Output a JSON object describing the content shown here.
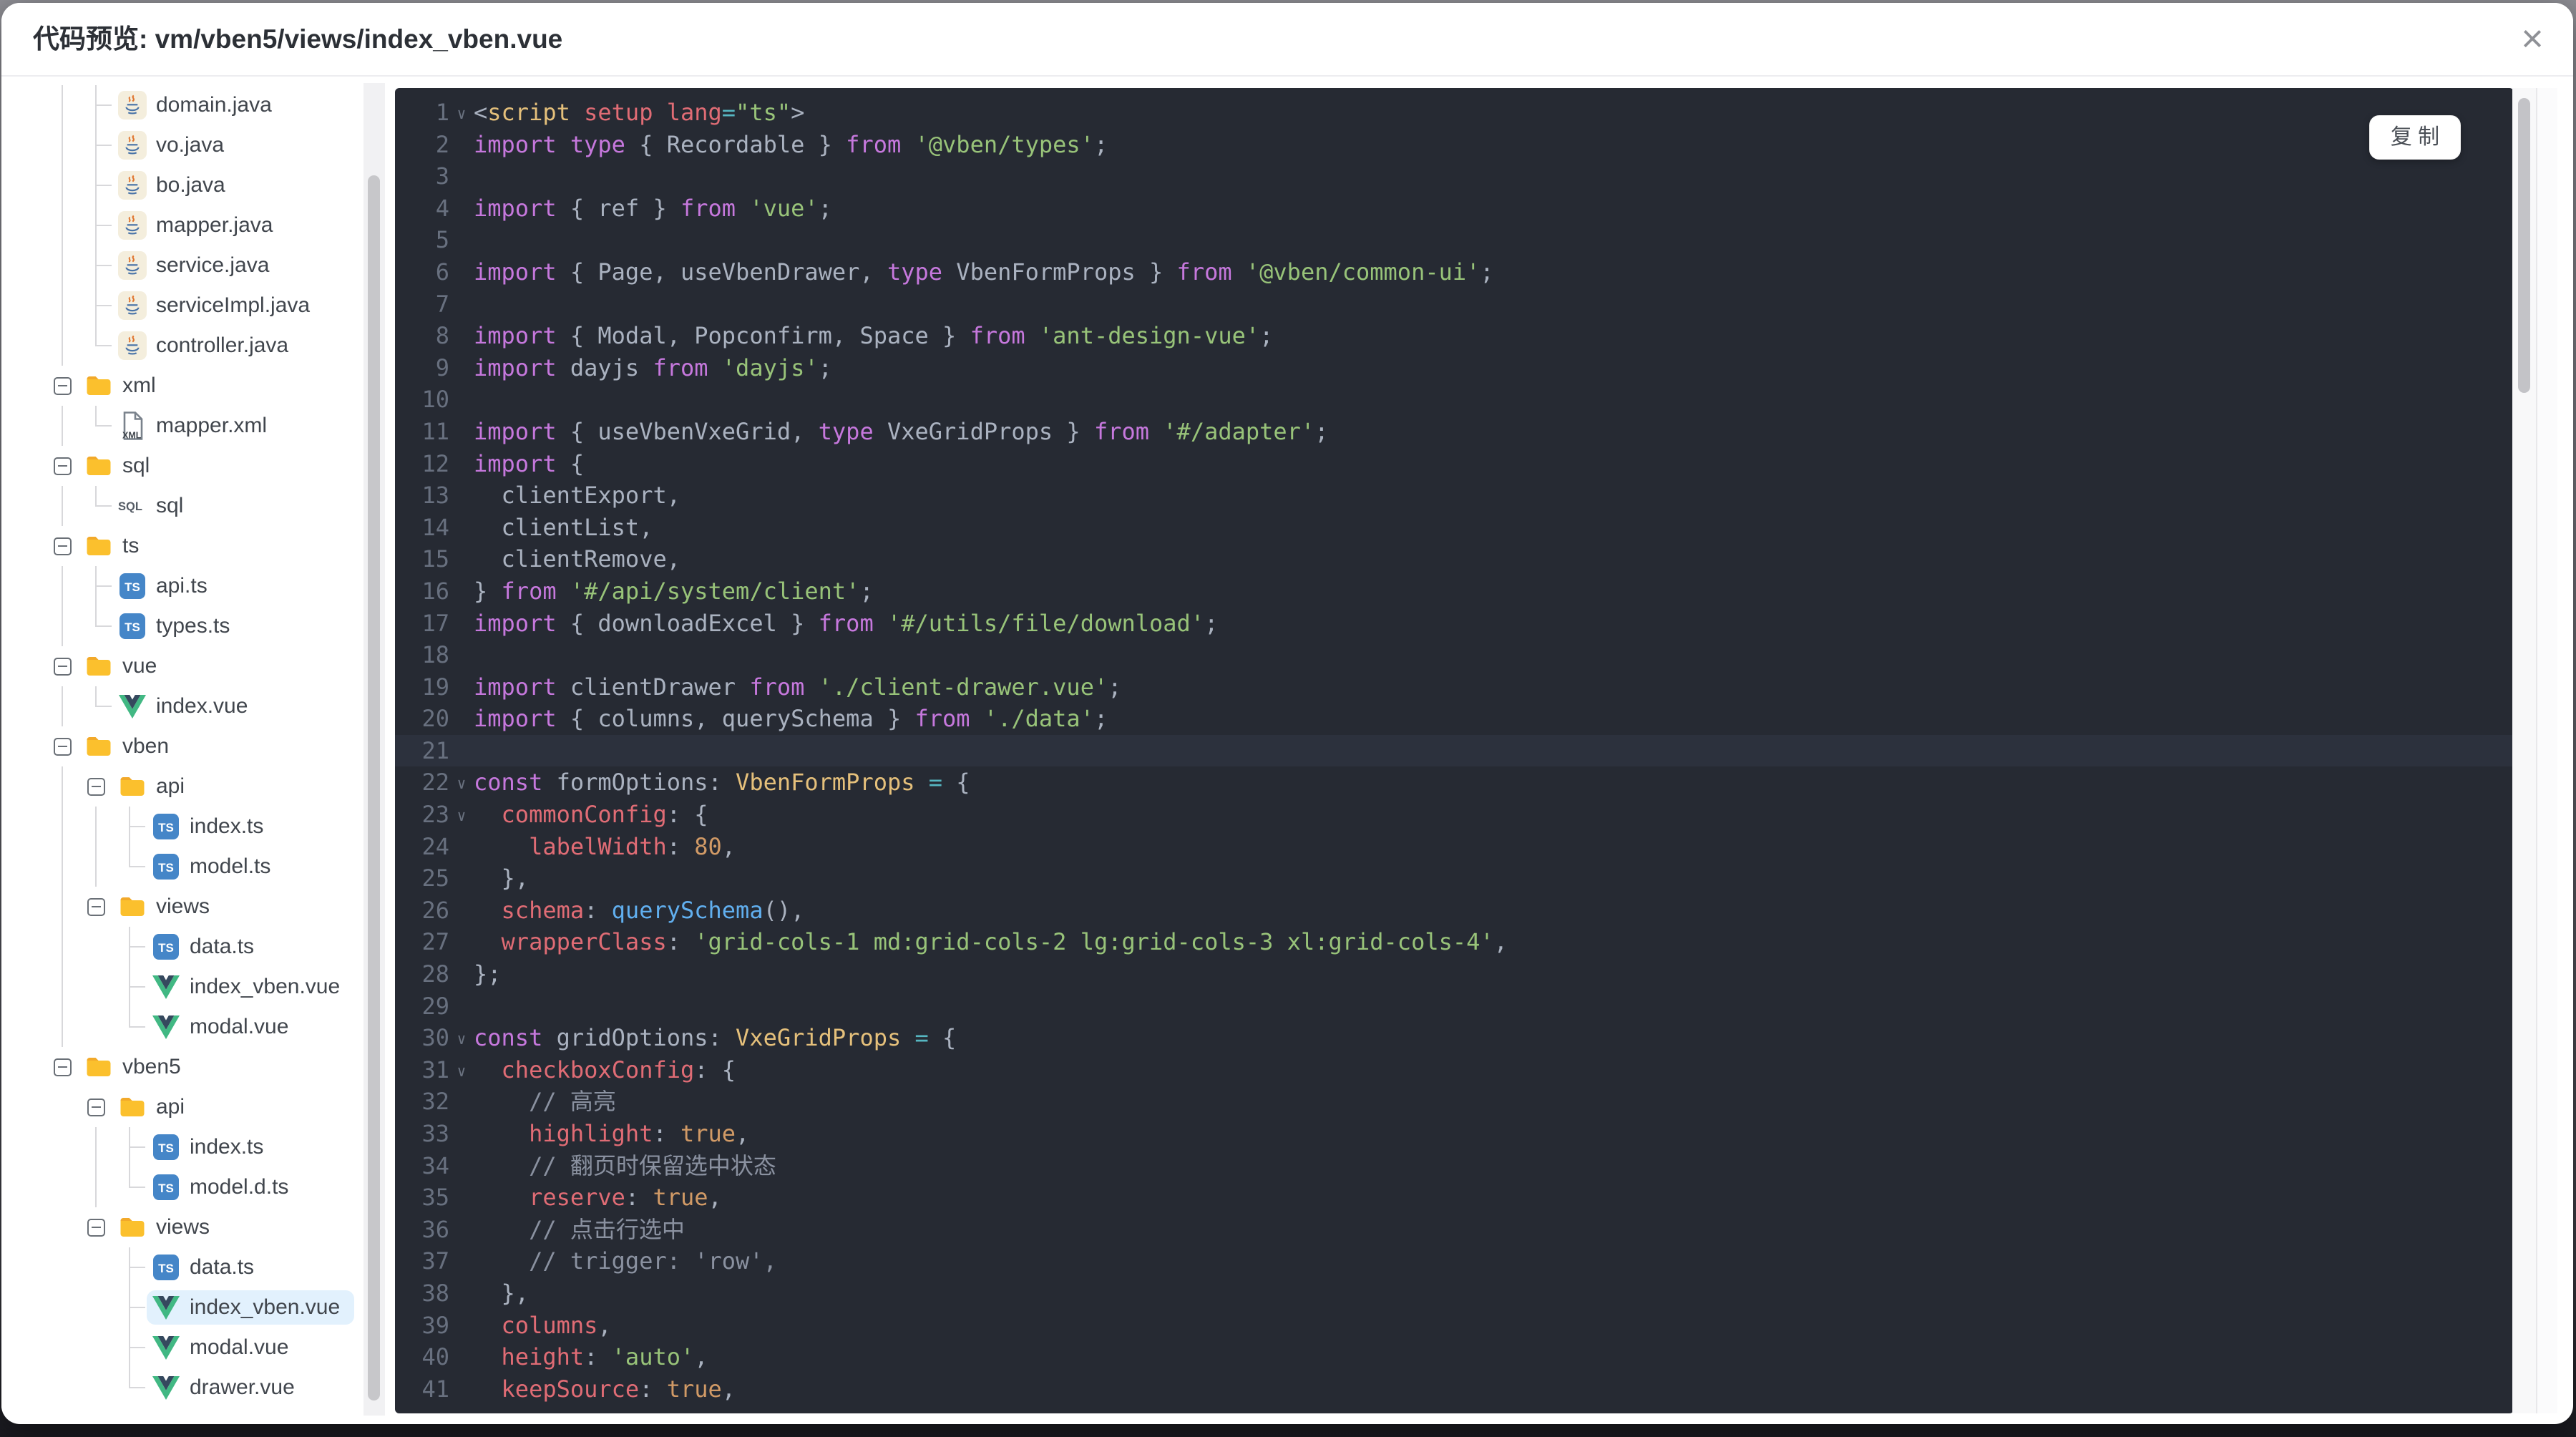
{
  "modal": {
    "title": "代码预览: vm/vben5/views/index_vben.vue",
    "close_icon": "×"
  },
  "code_panel": {
    "copy_button": "复 制"
  },
  "colors": {
    "editor_bg": "#262a33",
    "editor_line_highlight": "#2c313d",
    "tree_selected_bg": "#e2f1fd",
    "keyword": "#c678dd",
    "string": "#98c379",
    "property": "#e06c75",
    "number_bool": "#d19a66",
    "function": "#61afef",
    "type": "#e5c07b",
    "comment": "#8a91a0",
    "folder_icon": "#fbc02d",
    "ts_icon": "#4586c8",
    "vue_icon_green": "#41b883",
    "vue_icon_dark": "#35495e"
  },
  "tree": {
    "rows": [
      {
        "label": "domain.java",
        "icon": "java",
        "prefix": [
          "v",
          "t"
        ]
      },
      {
        "label": "vo.java",
        "icon": "java",
        "prefix": [
          "v",
          "t"
        ]
      },
      {
        "label": "bo.java",
        "icon": "java",
        "prefix": [
          "v",
          "t"
        ]
      },
      {
        "label": "mapper.java",
        "icon": "java",
        "prefix": [
          "v",
          "t"
        ]
      },
      {
        "label": "service.java",
        "icon": "java",
        "prefix": [
          "v",
          "t"
        ]
      },
      {
        "label": "serviceImpl.java",
        "icon": "java",
        "prefix": [
          "v",
          "t"
        ]
      },
      {
        "label": "controller.java",
        "icon": "java",
        "prefix": [
          "v",
          "l"
        ]
      },
      {
        "label": "xml",
        "icon": "folder",
        "expander": true,
        "prefix": []
      },
      {
        "label": "mapper.xml",
        "icon": "xml",
        "prefix": [
          "v",
          "l"
        ]
      },
      {
        "label": "sql",
        "icon": "folder",
        "expander": true,
        "prefix": []
      },
      {
        "label": "sql",
        "icon": "sql",
        "prefix": [
          "v",
          "l"
        ]
      },
      {
        "label": "ts",
        "icon": "folder",
        "expander": true,
        "prefix": []
      },
      {
        "label": "api.ts",
        "icon": "ts",
        "prefix": [
          "v",
          "t"
        ]
      },
      {
        "label": "types.ts",
        "icon": "ts",
        "prefix": [
          "v",
          "l"
        ]
      },
      {
        "label": "vue",
        "icon": "folder",
        "expander": true,
        "prefix": []
      },
      {
        "label": "index.vue",
        "icon": "vue",
        "prefix": [
          "v",
          "l"
        ]
      },
      {
        "label": "vben",
        "icon": "folder",
        "expander": true,
        "prefix": []
      },
      {
        "label": "api",
        "icon": "folder",
        "expander": true,
        "prefix": [
          "v"
        ]
      },
      {
        "label": "index.ts",
        "icon": "ts",
        "prefix": [
          "v",
          "v",
          "t"
        ]
      },
      {
        "label": "model.ts",
        "icon": "ts",
        "prefix": [
          "v",
          "v",
          "l"
        ]
      },
      {
        "label": "views",
        "icon": "folder",
        "expander": true,
        "prefix": [
          "v"
        ]
      },
      {
        "label": "data.ts",
        "icon": "ts",
        "prefix": [
          "v",
          "b",
          "t"
        ]
      },
      {
        "label": "index_vben.vue",
        "icon": "vue",
        "prefix": [
          "v",
          "b",
          "t"
        ]
      },
      {
        "label": "modal.vue",
        "icon": "vue",
        "prefix": [
          "v",
          "b",
          "l"
        ]
      },
      {
        "label": "vben5",
        "icon": "folder",
        "expander": true,
        "prefix": []
      },
      {
        "label": "api",
        "icon": "folder",
        "expander": true,
        "prefix": [
          "b"
        ]
      },
      {
        "label": "index.ts",
        "icon": "ts",
        "prefix": [
          "b",
          "v",
          "t"
        ]
      },
      {
        "label": "model.d.ts",
        "icon": "ts",
        "prefix": [
          "b",
          "v",
          "l"
        ]
      },
      {
        "label": "views",
        "icon": "folder",
        "expander": true,
        "prefix": [
          "b"
        ]
      },
      {
        "label": "data.ts",
        "icon": "ts",
        "prefix": [
          "b",
          "b",
          "t"
        ]
      },
      {
        "label": "index_vben.vue",
        "icon": "vue",
        "prefix": [
          "b",
          "b",
          "t"
        ],
        "selected": true
      },
      {
        "label": "modal.vue",
        "icon": "vue",
        "prefix": [
          "b",
          "b",
          "t"
        ]
      },
      {
        "label": "drawer.vue",
        "icon": "vue",
        "prefix": [
          "b",
          "b",
          "l"
        ]
      }
    ]
  },
  "code": {
    "fold_icon": "∨",
    "lines": [
      {
        "n": 1,
        "fold": true,
        "tok": [
          [
            "p",
            "<"
          ],
          [
            "t",
            "script"
          ],
          [
            "v",
            " "
          ],
          [
            "a",
            "setup"
          ],
          [
            "v",
            " "
          ],
          [
            "a",
            "lang"
          ],
          [
            "o",
            "="
          ],
          [
            "s",
            "\"ts\""
          ],
          [
            "p",
            ">"
          ]
        ]
      },
      {
        "n": 2,
        "tok": [
          [
            "k",
            "import"
          ],
          [
            "v",
            " "
          ],
          [
            "k",
            "type"
          ],
          [
            "v",
            " { Recordable } "
          ],
          [
            "k",
            "from"
          ],
          [
            "v",
            " "
          ],
          [
            "s",
            "'@vben/types'"
          ],
          [
            "v",
            ";"
          ]
        ]
      },
      {
        "n": 3,
        "tok": []
      },
      {
        "n": 4,
        "tok": [
          [
            "k",
            "import"
          ],
          [
            "v",
            " { ref } "
          ],
          [
            "k",
            "from"
          ],
          [
            "v",
            " "
          ],
          [
            "s",
            "'vue'"
          ],
          [
            "v",
            ";"
          ]
        ]
      },
      {
        "n": 5,
        "tok": []
      },
      {
        "n": 6,
        "tok": [
          [
            "k",
            "import"
          ],
          [
            "v",
            " { Page, useVbenDrawer, "
          ],
          [
            "k",
            "type"
          ],
          [
            "v",
            " VbenFormProps } "
          ],
          [
            "k",
            "from"
          ],
          [
            "v",
            " "
          ],
          [
            "s",
            "'@vben/common-ui'"
          ],
          [
            "v",
            ";"
          ]
        ]
      },
      {
        "n": 7,
        "tok": []
      },
      {
        "n": 8,
        "tok": [
          [
            "k",
            "import"
          ],
          [
            "v",
            " { Modal, Popconfirm, Space } "
          ],
          [
            "k",
            "from"
          ],
          [
            "v",
            " "
          ],
          [
            "s",
            "'ant-design-vue'"
          ],
          [
            "v",
            ";"
          ]
        ]
      },
      {
        "n": 9,
        "tok": [
          [
            "k",
            "import"
          ],
          [
            "v",
            " dayjs "
          ],
          [
            "k",
            "from"
          ],
          [
            "v",
            " "
          ],
          [
            "s",
            "'dayjs'"
          ],
          [
            "v",
            ";"
          ]
        ]
      },
      {
        "n": 10,
        "tok": []
      },
      {
        "n": 11,
        "tok": [
          [
            "k",
            "import"
          ],
          [
            "v",
            " { useVbenVxeGrid, "
          ],
          [
            "k",
            "type"
          ],
          [
            "v",
            " VxeGridProps } "
          ],
          [
            "k",
            "from"
          ],
          [
            "v",
            " "
          ],
          [
            "s",
            "'#/adapter'"
          ],
          [
            "v",
            ";"
          ]
        ]
      },
      {
        "n": 12,
        "tok": [
          [
            "k",
            "import"
          ],
          [
            "v",
            " {"
          ]
        ]
      },
      {
        "n": 13,
        "tok": [
          [
            "v",
            "  clientExport,"
          ]
        ]
      },
      {
        "n": 14,
        "tok": [
          [
            "v",
            "  clientList,"
          ]
        ]
      },
      {
        "n": 15,
        "tok": [
          [
            "v",
            "  clientRemove,"
          ]
        ]
      },
      {
        "n": 16,
        "tok": [
          [
            "v",
            "} "
          ],
          [
            "k",
            "from"
          ],
          [
            "v",
            " "
          ],
          [
            "s",
            "'#/api/system/client'"
          ],
          [
            "v",
            ";"
          ]
        ]
      },
      {
        "n": 17,
        "tok": [
          [
            "k",
            "import"
          ],
          [
            "v",
            " { downloadExcel } "
          ],
          [
            "k",
            "from"
          ],
          [
            "v",
            " "
          ],
          [
            "s",
            "'#/utils/file/download'"
          ],
          [
            "v",
            ";"
          ]
        ]
      },
      {
        "n": 18,
        "tok": []
      },
      {
        "n": 19,
        "tok": [
          [
            "k",
            "import"
          ],
          [
            "v",
            " clientDrawer "
          ],
          [
            "k",
            "from"
          ],
          [
            "v",
            " "
          ],
          [
            "s",
            "'./client-drawer.vue'"
          ],
          [
            "v",
            ";"
          ]
        ]
      },
      {
        "n": 20,
        "tok": [
          [
            "k",
            "import"
          ],
          [
            "v",
            " { columns, querySchema } "
          ],
          [
            "k",
            "from"
          ],
          [
            "v",
            " "
          ],
          [
            "s",
            "'./data'"
          ],
          [
            "v",
            ";"
          ]
        ]
      },
      {
        "n": 21,
        "hl": true,
        "tok": []
      },
      {
        "n": 22,
        "fold": true,
        "tok": [
          [
            "k",
            "const"
          ],
          [
            "v",
            " formOptions: "
          ],
          [
            "t",
            "VbenFormProps"
          ],
          [
            "o",
            " = "
          ],
          [
            "v",
            "{"
          ]
        ]
      },
      {
        "n": 23,
        "fold": true,
        "tok": [
          [
            "r",
            "  commonConfig"
          ],
          [
            "v",
            ": {"
          ]
        ]
      },
      {
        "n": 24,
        "tok": [
          [
            "r",
            "    labelWidth"
          ],
          [
            "v",
            ": "
          ],
          [
            "n",
            "80"
          ],
          [
            "v",
            ","
          ]
        ]
      },
      {
        "n": 25,
        "tok": [
          [
            "v",
            "  },"
          ]
        ]
      },
      {
        "n": 26,
        "tok": [
          [
            "r",
            "  schema"
          ],
          [
            "v",
            ": "
          ],
          [
            "f",
            "querySchema"
          ],
          [
            "v",
            "(),"
          ]
        ]
      },
      {
        "n": 27,
        "tok": [
          [
            "r",
            "  wrapperClass"
          ],
          [
            "v",
            ": "
          ],
          [
            "s",
            "'grid-cols-1 md:grid-cols-2 lg:grid-cols-3 xl:grid-cols-4'"
          ],
          [
            "v",
            ","
          ]
        ]
      },
      {
        "n": 28,
        "tok": [
          [
            "v",
            "};"
          ]
        ]
      },
      {
        "n": 29,
        "tok": []
      },
      {
        "n": 30,
        "fold": true,
        "tok": [
          [
            "k",
            "const"
          ],
          [
            "v",
            " gridOptions: "
          ],
          [
            "t",
            "VxeGridProps"
          ],
          [
            "o",
            " = "
          ],
          [
            "v",
            "{"
          ]
        ]
      },
      {
        "n": 31,
        "fold": true,
        "tok": [
          [
            "r",
            "  checkboxConfig"
          ],
          [
            "v",
            ": {"
          ]
        ]
      },
      {
        "n": 32,
        "tok": [
          [
            "c",
            "    // 高亮"
          ]
        ]
      },
      {
        "n": 33,
        "tok": [
          [
            "r",
            "    highlight"
          ],
          [
            "v",
            ": "
          ],
          [
            "n",
            "true"
          ],
          [
            "v",
            ","
          ]
        ]
      },
      {
        "n": 34,
        "tok": [
          [
            "c",
            "    // 翻页时保留选中状态"
          ]
        ]
      },
      {
        "n": 35,
        "tok": [
          [
            "r",
            "    reserve"
          ],
          [
            "v",
            ": "
          ],
          [
            "n",
            "true"
          ],
          [
            "v",
            ","
          ]
        ]
      },
      {
        "n": 36,
        "tok": [
          [
            "c",
            "    // 点击行选中"
          ]
        ]
      },
      {
        "n": 37,
        "tok": [
          [
            "c",
            "    // trigger: 'row',"
          ]
        ]
      },
      {
        "n": 38,
        "tok": [
          [
            "v",
            "  },"
          ]
        ]
      },
      {
        "n": 39,
        "tok": [
          [
            "r",
            "  columns"
          ],
          [
            "v",
            ","
          ]
        ]
      },
      {
        "n": 40,
        "tok": [
          [
            "r",
            "  height"
          ],
          [
            "v",
            ": "
          ],
          [
            "s",
            "'auto'"
          ],
          [
            "v",
            ","
          ]
        ]
      },
      {
        "n": 41,
        "tok": [
          [
            "r",
            "  keepSource"
          ],
          [
            "v",
            ": "
          ],
          [
            "n",
            "true"
          ],
          [
            "v",
            ","
          ]
        ]
      }
    ]
  }
}
